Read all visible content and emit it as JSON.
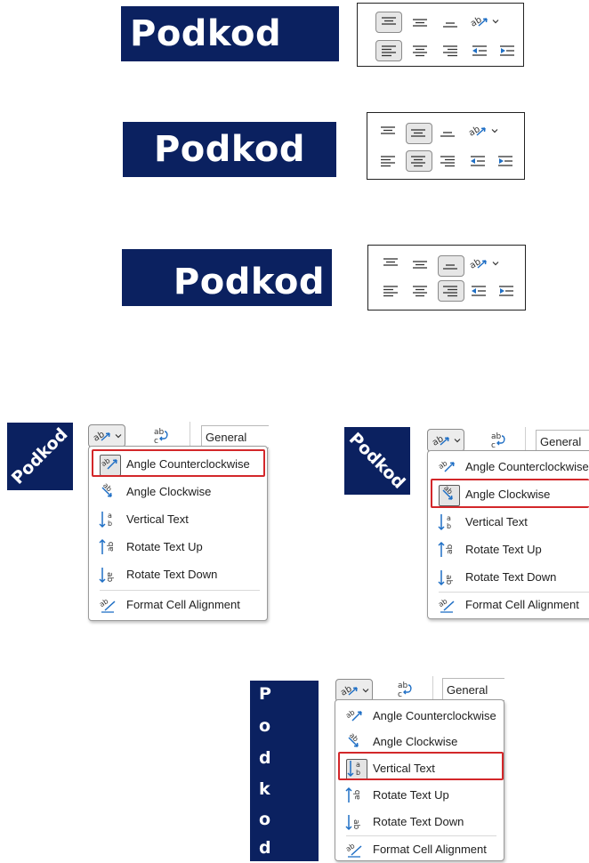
{
  "cells": {
    "horizontal_text": "Podkod",
    "rotated_text": "Podkod",
    "vertical_letters": [
      "P",
      "o",
      "d",
      "k",
      "o",
      "d"
    ]
  },
  "ribbon": {
    "number_format": "General"
  },
  "orientation_menu": {
    "items": [
      {
        "label": "Angle Counterclockwise",
        "icon": "angle-counterclockwise-icon"
      },
      {
        "label": "Angle Clockwise",
        "icon": "angle-clockwise-icon"
      },
      {
        "label": "Vertical Text",
        "icon": "vertical-text-icon"
      },
      {
        "label": "Rotate Text Up",
        "icon": "rotate-text-up-icon"
      },
      {
        "label": "Rotate Text Down",
        "icon": "rotate-text-down-icon"
      },
      {
        "label": "Format Cell Alignment",
        "icon": "format-cell-alignment-icon"
      }
    ]
  },
  "colors": {
    "cell_background": "#0b2160",
    "highlight": "#d3272a",
    "accent_blue": "#1f6fc5"
  }
}
